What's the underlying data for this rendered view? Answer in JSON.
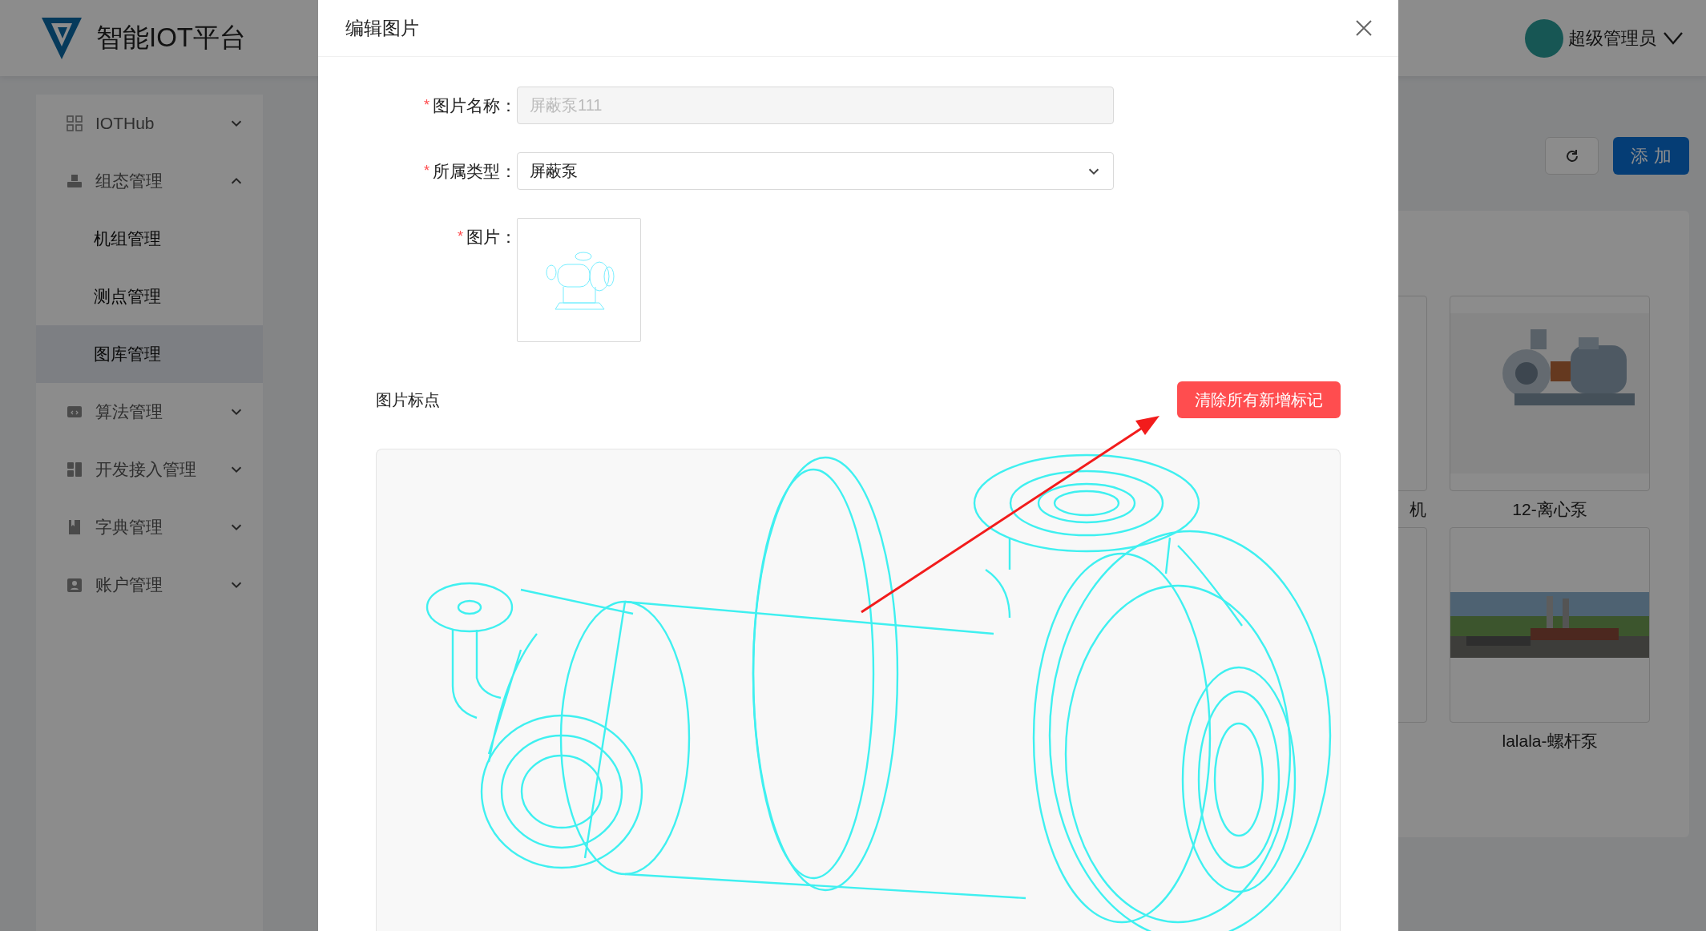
{
  "header": {
    "title": "智能IOT平台",
    "user": {
      "name": "超级管理员"
    }
  },
  "sidebar": {
    "items": [
      {
        "label": "IOTHub",
        "expanded": false
      },
      {
        "label": "组态管理",
        "expanded": true,
        "children": [
          {
            "label": "机组管理",
            "selected": false
          },
          {
            "label": "测点管理",
            "selected": false
          },
          {
            "label": "图库管理",
            "selected": true
          }
        ]
      },
      {
        "label": "算法管理",
        "expanded": false
      },
      {
        "label": "开发接入管理",
        "expanded": false
      },
      {
        "label": "字典管理",
        "expanded": false
      },
      {
        "label": "账户管理",
        "expanded": false
      }
    ]
  },
  "toolbar": {
    "add_button": "添 加"
  },
  "cards": [
    {
      "caption": "机"
    },
    {
      "caption": "12-离心泵",
      "kind": "picture"
    },
    {
      "kind": "blank"
    },
    {
      "caption": "lalala-螺杆泵",
      "kind": "picture"
    }
  ],
  "modal": {
    "title": "编辑图片",
    "fields": [
      {
        "required_mark": "*",
        "label": "图片名称：",
        "kind": "input",
        "value": "屏蔽泵111",
        "disabled": true
      },
      {
        "required_mark": "*",
        "label": "所属类型：",
        "kind": "select",
        "value": "屏蔽泵"
      },
      {
        "required_mark": "*",
        "label": "图片："
      }
    ],
    "section_title": "图片标点",
    "clear_button": "清除所有新增标记"
  }
}
